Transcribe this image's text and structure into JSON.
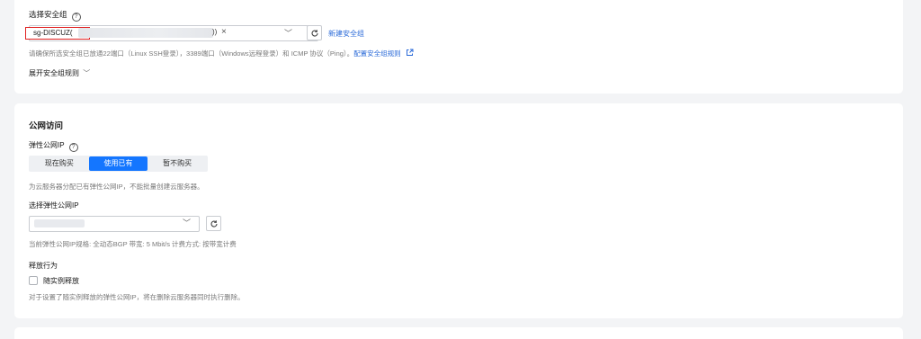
{
  "security_group": {
    "label": "选择安全组",
    "help_icon": "?",
    "selected_tag": "sg-DISCUZ(",
    "selected_tail": "))",
    "clear_icon": "×",
    "chevron_icon": "﹀",
    "create_link": "新建安全组",
    "note_prefix": "请确保所选安全组已放通22端口（Linux SSH登录），3389端口（Windows远程登录）和 ICMP 协议（Ping）。",
    "note_link": "配置安全组规则",
    "note_link_icon": "external-link-icon",
    "expand_rules": "展开安全组规则",
    "expand_icon": "﹀"
  },
  "public_access": {
    "section_title": "公网访问",
    "eip_label": "弹性公网IP",
    "help_icon": "?",
    "options": [
      "现在购买",
      "使用已有",
      "暂不购买"
    ],
    "selected_option": "使用已有",
    "eip_hint": "为云服务器分配已有弹性公网IP，不能批量创建云服务器。",
    "select_eip_label": "选择弹性公网IP",
    "eip_chevron": "﹀",
    "eip_spec": "当前弹性公网IP规格: 全动态BGP   带宽: 5 Mbit/s   计费方式: 按带宽计费",
    "release_label": "释放行为",
    "release_checkbox_label": "随实例释放",
    "release_note": "对于设置了随实例释放的弹性公网IP，将在删除云服务器同时执行删除。"
  },
  "colors": {
    "accent": "#1476ff",
    "link": "#2a6ad8",
    "highlight_border": "#e02020",
    "page_bg": "#f3f4f6"
  }
}
